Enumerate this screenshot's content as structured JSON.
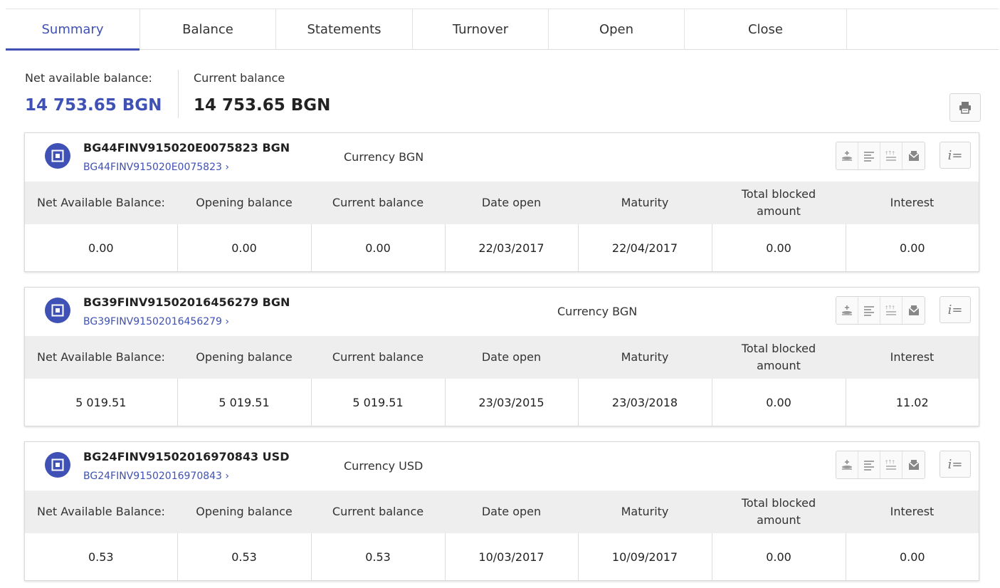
{
  "tabs": [
    {
      "label": "Summary",
      "active": true
    },
    {
      "label": "Balance",
      "active": false
    },
    {
      "label": "Statements",
      "active": false
    },
    {
      "label": "Turnover",
      "active": false
    },
    {
      "label": "Open",
      "active": false
    },
    {
      "label": "Close",
      "active": false
    },
    {
      "label": "",
      "active": false
    }
  ],
  "summary": {
    "net_label": "Net available balance:",
    "net_value": "14 753.65 BGN",
    "current_label": "Current balance",
    "current_value": "14 753.65 BGN"
  },
  "columns": [
    "Net Available Balance:",
    "Opening balance",
    "Current balance",
    "Date open",
    "Maturity",
    "Total blocked amount",
    "Interest"
  ],
  "accounts": [
    {
      "title": "BG44FINV915020E0075823 BGN",
      "link": "BG44FINV915020E0075823 ›",
      "currency": "Currency BGN",
      "values": [
        "0.00",
        "0.00",
        "0.00",
        "22/03/2017",
        "22/04/2017",
        "0.00",
        "0.00"
      ]
    },
    {
      "title": "BG39FINV91502016456279 BGN",
      "link": "BG39FINV91502016456279 ›",
      "currency": "Currency BGN",
      "values": [
        "5 019.51",
        "5 019.51",
        "5 019.51",
        "23/03/2015",
        "23/03/2018",
        "0.00",
        "11.02"
      ]
    },
    {
      "title": "BG24FINV91502016970843 USD",
      "link": "BG24FINV91502016970843 ›",
      "currency": "Currency USD",
      "values": [
        "0.53",
        "0.53",
        "0.53",
        "10/03/2017",
        "10/09/2017",
        "0.00",
        "0.00"
      ]
    }
  ],
  "icons": {
    "account": "safe-icon",
    "print": "print-icon",
    "actions": [
      "deposit-icon",
      "list-icon",
      "transfer-icon",
      "mail-icon",
      "info-list-icon"
    ],
    "info_glyph": "i="
  },
  "colors": {
    "accent": "#3f51b5",
    "header_bg": "#eeeeee",
    "border": "#d9d9d9"
  }
}
